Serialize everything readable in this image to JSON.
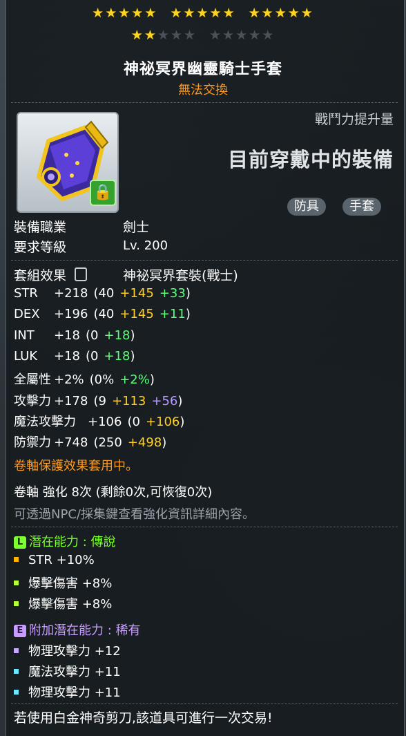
{
  "stars": {
    "total": 25,
    "filled": 17
  },
  "item": {
    "name": "神祕冥界幽靈騎士手套",
    "trade_status": "無法交換"
  },
  "power_increase_label": "戰鬥力提升量",
  "equipped_label": "目前穿戴中的裝備",
  "tags": [
    "防具",
    "手套"
  ],
  "requirements": {
    "job_label": "裝備職業",
    "job_value": "劍士",
    "level_label": "要求等級",
    "level_value": "Lv. 200"
  },
  "set": {
    "label": "套組效果",
    "value": "神祕冥界套裝(戰士)"
  },
  "stats": [
    {
      "name": "STR",
      "total": "+218",
      "base": "(40",
      "add1": "+145",
      "add1_color": "#ffd021",
      "add2": "+33",
      "add2_color": "#5cff7a",
      "close": ")"
    },
    {
      "name": "DEX",
      "total": "+196",
      "base": "(40",
      "add1": "+145",
      "add1_color": "#ffd021",
      "add2": "+11",
      "add2_color": "#5cff7a",
      "close": ")"
    },
    {
      "name": "INT",
      "total": "+18",
      "base": "(0",
      "add1": "+18",
      "add1_color": "#5cff7a",
      "add2": "",
      "add2_color": "",
      "close": ")"
    },
    {
      "name": "LUK",
      "total": "+18",
      "base": "(0",
      "add1": "+18",
      "add1_color": "#5cff7a",
      "add2": "",
      "add2_color": "",
      "close": ")"
    },
    {
      "name": "全屬性",
      "total": "+2%",
      "base": "(0%",
      "add1": "+2%",
      "add1_color": "#5cff7a",
      "add2": "",
      "add2_color": "",
      "close": ")"
    },
    {
      "name": "攻擊力",
      "total": "+178",
      "base": "(9",
      "add1": "+113",
      "add1_color": "#ffd021",
      "add2": "+56",
      "add2_color": "#b79bff",
      "close": ")"
    },
    {
      "name": "魔法攻擊力",
      "total": "+106",
      "base": "(0",
      "add1": "+106",
      "add1_color": "#ffd021",
      "add2": "",
      "add2_color": "",
      "close": ")"
    },
    {
      "name": "防禦力",
      "total": "+748",
      "base": "(250",
      "add1": "+498",
      "add1_color": "#ffd021",
      "add2": "",
      "add2_color": "",
      "close": ")"
    }
  ],
  "scroll_protect": "卷軸保護效果套用中。",
  "scroll_enhance": "卷軸 強化 8次 (剩餘0次,可恢復0次)",
  "scroll_hint": "可透過NPC/採集鍵查看強化資訊詳細內容。",
  "potential": {
    "badge": "L",
    "label": "潛在能力 : 傳說",
    "lines": [
      {
        "text": "STR +10%",
        "bullet_color": "#ffb400"
      },
      {
        "text": "爆擊傷害 +8%",
        "bullet_color": "#b6ff3a"
      },
      {
        "text": "爆擊傷害 +8%",
        "bullet_color": "#b6ff3a"
      }
    ]
  },
  "additional_potential": {
    "badge": "E",
    "label": "附加潛在能力 : 稀有",
    "lines": [
      {
        "text": "物理攻擊力 +12",
        "bullet_color": "#c8a8ff"
      },
      {
        "text": "魔法攻擊力 +11",
        "bullet_color": "#6ee6ff"
      },
      {
        "text": "物理攻擊力 +11",
        "bullet_color": "#6ee6ff"
      }
    ]
  },
  "footer_note": "若使用白金神奇剪刀,該道具可進行一次交易!",
  "colors": {
    "legend": "#7cff2e",
    "epic": "#c89bff",
    "orange": "#ff9a1e"
  }
}
